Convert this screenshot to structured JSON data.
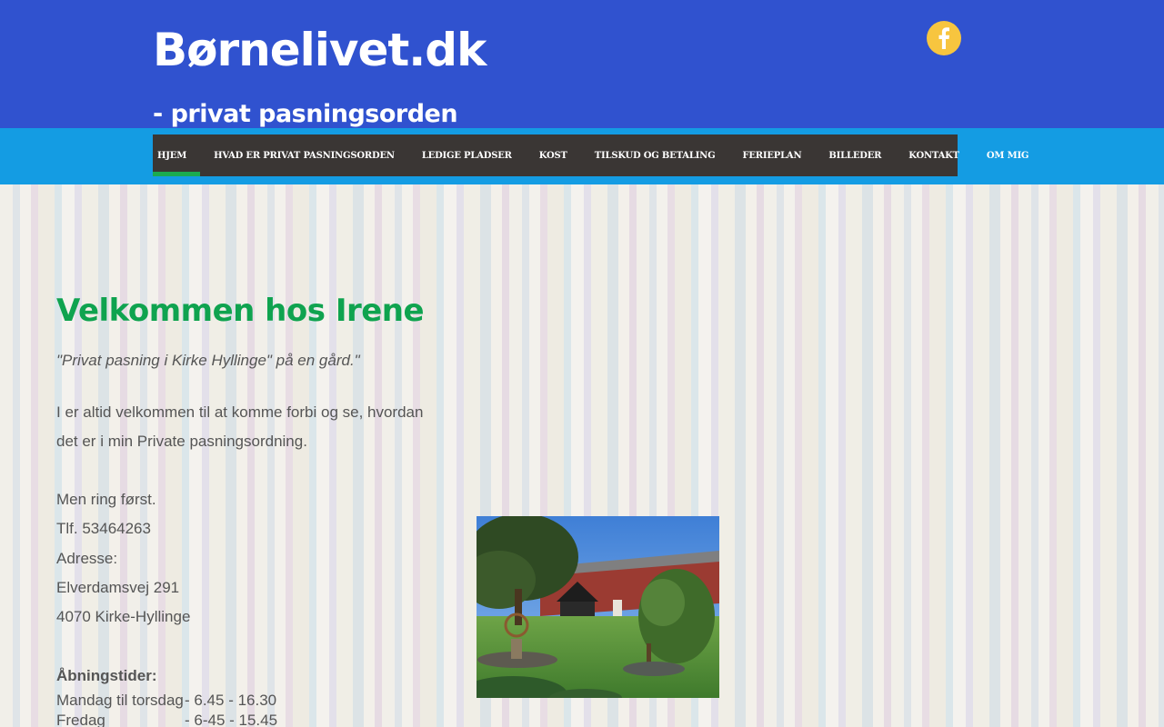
{
  "header": {
    "title": "Børnelivet.dk",
    "subtitle": "-  privat pasningsorden",
    "facebook_icon": "facebook-icon"
  },
  "nav": {
    "items": [
      {
        "label": "HJEM",
        "active": true
      },
      {
        "label": "HVAD ER PRIVAT PASNINGSORDEN",
        "active": false
      },
      {
        "label": "LEDIGE PLADSER",
        "active": false
      },
      {
        "label": "KOST",
        "active": false
      },
      {
        "label": "TILSKUD OG BETALING",
        "active": false
      },
      {
        "label": "FERIEPLAN",
        "active": false
      },
      {
        "label": "BILLEDER",
        "active": false
      },
      {
        "label": "KONTAKT",
        "active": false
      },
      {
        "label": "OM MIG",
        "active": false
      }
    ]
  },
  "main": {
    "heading": "Velkommen hos Irene",
    "quote": "\"Privat pasning i Kirke Hyllinge\" på en gård.\"",
    "intro": "I er altid velkommen til at komme forbi og se, hvordan det er i min  Private pasningsordning.",
    "ring_first": "Men ring først.",
    "phone": "Tlf. 53464263",
    "address_label": "Adresse:",
    "street": "Elverdamsvej 291",
    "city": "4070 Kirke-Hyllinge",
    "hours_label": "Åbningstider:",
    "hours": [
      {
        "days": "Mandag til torsdag",
        "time": "-  6.45 - 16.30"
      },
      {
        "days": "Fredag",
        "time": "-  6-45 - 15.45"
      }
    ]
  },
  "colors": {
    "header_bg": "#3052cf",
    "nav_band": "#149ce3",
    "nav_bg": "#3a3634",
    "accent_green": "#0fa34f",
    "facebook_button": "#f7c53f"
  }
}
